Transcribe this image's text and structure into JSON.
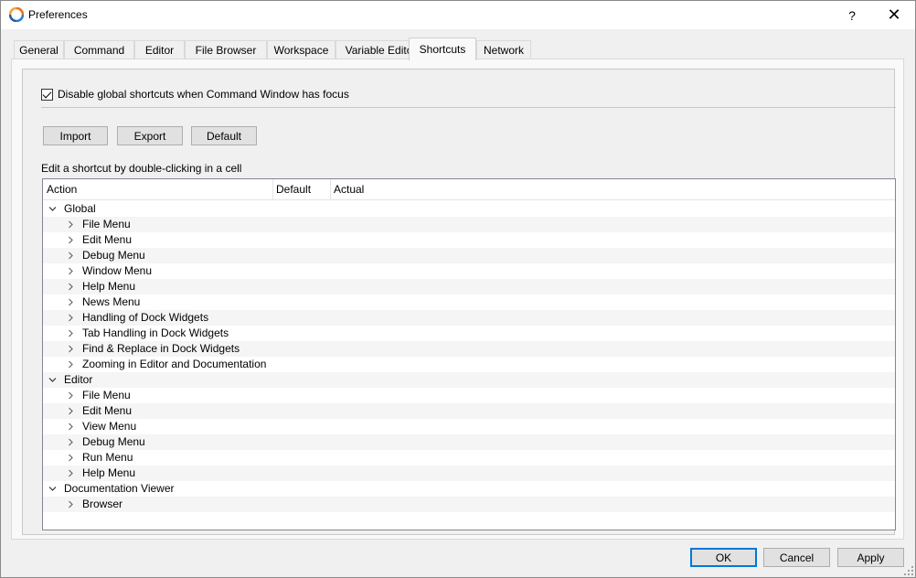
{
  "window": {
    "title": "Preferences",
    "help_label": "?",
    "close_label": "✕"
  },
  "tabs": [
    {
      "label": "General",
      "active": false
    },
    {
      "label": "Command",
      "active": false
    },
    {
      "label": "Editor",
      "active": false
    },
    {
      "label": "File Browser",
      "active": false
    },
    {
      "label": "Workspace",
      "active": false
    },
    {
      "label": "Variable Editor",
      "active": false
    },
    {
      "label": "Shortcuts",
      "active": true
    },
    {
      "label": "Network",
      "active": false
    }
  ],
  "shortcuts": {
    "disable_global_label": "Disable global shortcuts when Command Window has focus",
    "disable_global_checked": true,
    "import_label": "Import",
    "export_label": "Export",
    "default_label": "Default",
    "hint": "Edit a shortcut by double-clicking in a cell",
    "columns": [
      "Action",
      "Default",
      "Actual"
    ]
  },
  "tree": [
    {
      "label": "Global",
      "level": 0,
      "expanded": true
    },
    {
      "label": "File Menu",
      "level": 1,
      "expanded": false
    },
    {
      "label": "Edit Menu",
      "level": 1,
      "expanded": false
    },
    {
      "label": "Debug Menu",
      "level": 1,
      "expanded": false
    },
    {
      "label": "Window Menu",
      "level": 1,
      "expanded": false
    },
    {
      "label": "Help Menu",
      "level": 1,
      "expanded": false
    },
    {
      "label": "News Menu",
      "level": 1,
      "expanded": false
    },
    {
      "label": "Handling of Dock Widgets",
      "level": 1,
      "expanded": false
    },
    {
      "label": "Tab Handling in Dock Widgets",
      "level": 1,
      "expanded": false
    },
    {
      "label": "Find & Replace in Dock Widgets",
      "level": 1,
      "expanded": false
    },
    {
      "label": "Zooming in Editor and Documentation",
      "level": 1,
      "expanded": false
    },
    {
      "label": "Editor",
      "level": 0,
      "expanded": true
    },
    {
      "label": "File Menu",
      "level": 1,
      "expanded": false
    },
    {
      "label": "Edit Menu",
      "level": 1,
      "expanded": false
    },
    {
      "label": "View Menu",
      "level": 1,
      "expanded": false
    },
    {
      "label": "Debug Menu",
      "level": 1,
      "expanded": false
    },
    {
      "label": "Run Menu",
      "level": 1,
      "expanded": false
    },
    {
      "label": "Help Menu",
      "level": 1,
      "expanded": false
    },
    {
      "label": "Documentation Viewer",
      "level": 0,
      "expanded": true
    },
    {
      "label": "Browser",
      "level": 1,
      "expanded": false
    }
  ],
  "footer": {
    "ok_label": "OK",
    "cancel_label": "Cancel",
    "apply_label": "Apply"
  },
  "colors": {
    "accent": "#0078d7",
    "row_alt": "#f5f5f5"
  }
}
